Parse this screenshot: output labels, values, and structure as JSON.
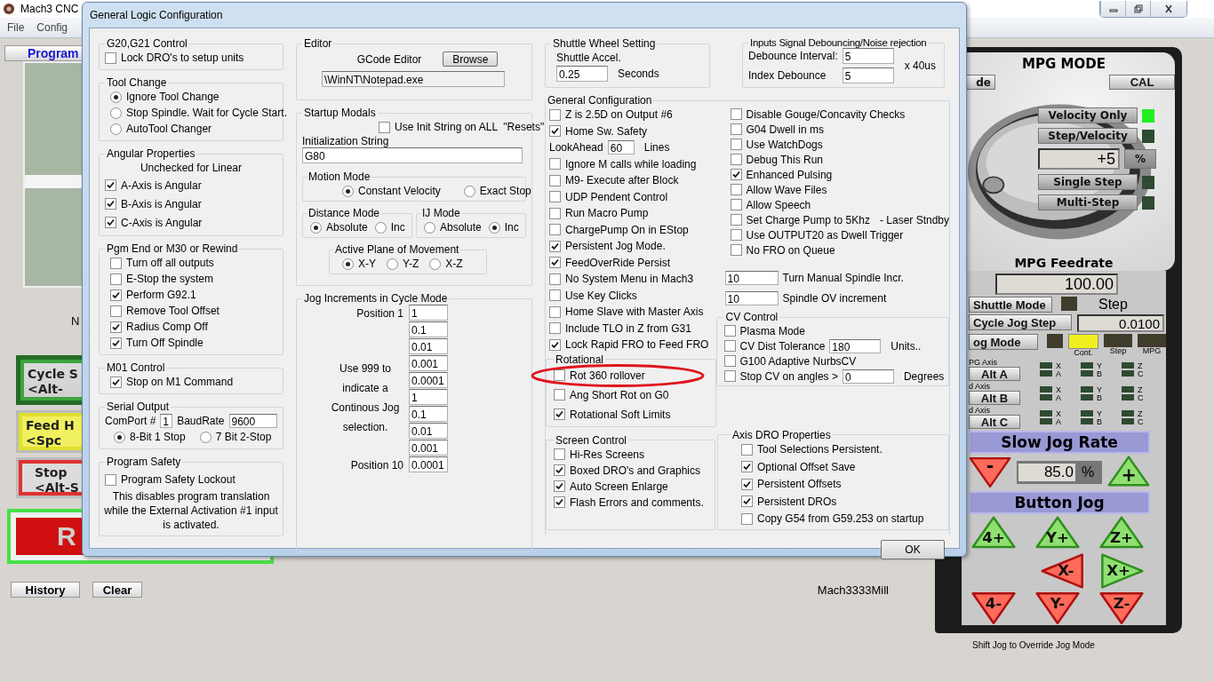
{
  "app": {
    "title": "Mach3 CNC",
    "menu": [
      "File",
      "Config"
    ],
    "tab": "Program",
    "left_label": "N",
    "big_buttons": [
      {
        "kind": "green",
        "lines": [
          "Cycle S",
          "<Alt-"
        ]
      },
      {
        "kind": "yellow",
        "lines": [
          "Feed H",
          "<Spc"
        ]
      },
      {
        "kind": "red",
        "lines": [
          "Stop",
          "<Alt-S"
        ]
      }
    ],
    "run_button": "R",
    "bottom_buttons": [
      "History",
      "Clear"
    ],
    "profile": "Mach3333Mill"
  },
  "mpg": {
    "mode_button": "de",
    "title": "MPG MODE",
    "cal": "CAL",
    "modes": [
      {
        "label": "Velocity Only",
        "on": true
      },
      {
        "label": "Step/Velocity",
        "on": false
      },
      {
        "kind": "dro",
        "value": "+5",
        "unit": "%"
      },
      {
        "label": "Single Step",
        "on": false
      },
      {
        "label": "Multi-Step",
        "on": false
      }
    ],
    "feedrate_label": "MPG Feedrate",
    "feedrate": "100.00",
    "shuttle": {
      "label": "Shuttle Mode",
      "on": false,
      "unit": "Step"
    },
    "cycle_jog": {
      "label": "Cycle Jog Step",
      "value": "0.0100"
    },
    "jog_mode": {
      "label": "og Mode",
      "on": false,
      "modes": [
        {
          "label": "Cont.",
          "on": true
        },
        {
          "label": "Step",
          "on": false
        },
        {
          "label": "MPG",
          "on": false
        }
      ]
    },
    "axes": [
      {
        "caption": "PG Axis",
        "button": "Alt A",
        "letters": [
          [
            "X",
            "A"
          ],
          [
            "Y",
            "B"
          ],
          [
            "Z",
            "C"
          ]
        ]
      },
      {
        "caption": "d Axis",
        "button": "Alt B",
        "letters": [
          [
            "X",
            "A"
          ],
          [
            "Y",
            "B"
          ],
          [
            "Z",
            "C"
          ]
        ]
      },
      {
        "caption": "d Axis",
        "button": "Alt C",
        "letters": [
          [
            "X",
            "A"
          ],
          [
            "Y",
            "B"
          ],
          [
            "Z",
            "C"
          ]
        ]
      }
    ],
    "slow_jog": {
      "title": "Slow Jog Rate",
      "minus": {
        "label": "-",
        "kind": "down"
      },
      "value": "85.0",
      "unit": "%",
      "plus": {
        "label": "+",
        "kind": "up"
      }
    },
    "button_jog": "Button Jog",
    "jog_buttons": [
      {
        "label": "4+",
        "kind": "up"
      },
      {
        "label": "Y+",
        "kind": "up"
      },
      {
        "label": "Z+",
        "kind": "up"
      },
      {
        "label": "X-",
        "kind": "left"
      },
      {
        "label": "X+",
        "kind": "right"
      },
      {
        "label": "4-",
        "kind": "down"
      },
      {
        "label": "Y-",
        "kind": "down"
      },
      {
        "label": "Z-",
        "kind": "down"
      }
    ],
    "hint": "Shift Jog to Override Jog Mode"
  },
  "dialog": {
    "title": "General Logic Configuration",
    "ok": "OK",
    "g20": {
      "title": "G20,G21 Control",
      "checkboxes": [
        {
          "label": "Lock DRO's to setup units",
          "checked": false
        }
      ]
    },
    "tool_change": {
      "title": "Tool Change",
      "radios": [
        {
          "label": "Ignore Tool Change",
          "selected": true
        },
        {
          "label": "Stop Spindle. Wait for Cycle Start.",
          "selected": false
        },
        {
          "label": "AutoTool Changer",
          "selected": false
        }
      ]
    },
    "angular": {
      "title": "Angular Properties",
      "note": "Unchecked for Linear",
      "checkboxes": [
        {
          "label": "A-Axis is Angular",
          "checked": true
        },
        {
          "label": "B-Axis is Angular",
          "checked": true
        },
        {
          "label": "C-Axis is Angular",
          "checked": true
        }
      ]
    },
    "pgm_end": {
      "title": "Pgm End or M30 or Rewind",
      "checkboxes": [
        {
          "label": "Turn off all outputs",
          "checked": false
        },
        {
          "label": "E-Stop the system",
          "checked": false
        },
        {
          "label": "Perform G92.1",
          "checked": true
        },
        {
          "label": "Remove Tool Offset",
          "checked": false
        },
        {
          "label": "Radius Comp Off",
          "checked": true
        },
        {
          "label": "Turn Off Spindle",
          "checked": true
        }
      ]
    },
    "m01": {
      "title": "M01 Control",
      "checkboxes": [
        {
          "label": "Stop on M1 Command",
          "checked": true
        }
      ]
    },
    "serial": {
      "title": "Serial Output",
      "comport_label": "ComPort #",
      "comport": "1",
      "baud_label": "BaudRate",
      "baud": "9600",
      "radios": [
        {
          "label": "8-Bit 1 Stop",
          "selected": true
        },
        {
          "label": "7 Bit 2-Stop",
          "selected": false
        }
      ]
    },
    "safety": {
      "title": "Program Safety",
      "checkboxes": [
        {
          "label": "Program Safety Lockout",
          "checked": false
        }
      ],
      "note": "This disables program translation while the External Activation #1 input is activated."
    },
    "editor": {
      "title": "Editor",
      "label": "GCode Editor",
      "browse": "Browse",
      "path": "\\WinNT\\Notepad.exe"
    },
    "startup": {
      "title": "Startup Modals",
      "init_all": {
        "label": "Use Init String on ALL  \"Resets\"",
        "checked": false
      },
      "init_label": "Initialization String",
      "init_value": "G80",
      "motion": {
        "title": "Motion Mode",
        "radios": [
          {
            "label": "Constant Velocity",
            "selected": true
          },
          {
            "label": "Exact Stop",
            "selected": false
          }
        ]
      },
      "distance": {
        "title": "Distance Mode",
        "radios": [
          {
            "label": "Absolute",
            "selected": true
          },
          {
            "label": "Inc",
            "selected": false
          }
        ]
      },
      "ij": {
        "title": "IJ Mode",
        "radios": [
          {
            "label": "Absolute",
            "selected": false
          },
          {
            "label": "Inc",
            "selected": true
          }
        ]
      },
      "plane": {
        "title": "Active Plane of Movement",
        "radios": [
          {
            "label": "X-Y",
            "selected": true
          },
          {
            "label": "Y-Z",
            "selected": false
          },
          {
            "label": "X-Z",
            "selected": false
          }
        ]
      }
    },
    "jog": {
      "title": "Jog Increments in Cycle Mode",
      "first_label": "Position 1",
      "last_label": "Position 10",
      "note": "Use 999 to indicate a Continous Jog selection.",
      "values": [
        "1",
        "0.1",
        "0.01",
        "0.001",
        "0.0001",
        "1",
        "0.1",
        "0.01",
        "0.001",
        "0.0001"
      ]
    },
    "shuttle": {
      "title": "Shuttle Wheel Setting",
      "label": "Shuttle Accel.",
      "value": "0.25",
      "unit": "Seconds"
    },
    "debounce": {
      "title": "Inputs Signal Debouncing/Noise rejection",
      "interval_label": "Debounce Interval:",
      "interval": "5",
      "index_label": "Index Debounce",
      "index": "5",
      "unit": "x 40us"
    },
    "general": {
      "title": "General Configuration",
      "left": [
        {
          "kind": "checkbox",
          "label": "Z is 2.5D on Output #6",
          "checked": false
        },
        {
          "kind": "checkbox",
          "label": "Home Sw. Safety",
          "checked": true
        },
        {
          "kind": "field",
          "label": "LookAhead",
          "value": "60",
          "unit": "Lines"
        },
        {
          "kind": "checkbox",
          "label": "Ignore M calls while loading",
          "checked": false
        },
        {
          "kind": "checkbox",
          "label": "M9- Execute after Block",
          "checked": false
        },
        {
          "kind": "checkbox",
          "label": "UDP Pendent Control",
          "checked": false
        },
        {
          "kind": "checkbox",
          "label": "Run Macro Pump",
          "checked": false
        },
        {
          "kind": "checkbox",
          "label": "ChargePump On in EStop",
          "checked": false
        },
        {
          "kind": "checkbox",
          "label": "Persistent Jog Mode.",
          "checked": true
        },
        {
          "kind": "checkbox",
          "label": "FeedOverRide Persist",
          "checked": true
        },
        {
          "kind": "checkbox",
          "label": "No System Menu in Mach3",
          "checked": false
        },
        {
          "kind": "checkbox",
          "label": "Use Key Clicks",
          "checked": false
        },
        {
          "kind": "checkbox",
          "label": "Home Slave with Master Axis",
          "checked": false
        },
        {
          "kind": "checkbox",
          "label": "Include TLO in Z from G31",
          "checked": false
        },
        {
          "kind": "checkbox",
          "label": "Lock Rapid FRO to Feed FRO",
          "checked": true
        }
      ],
      "rotational": {
        "title": "Rotational",
        "checkboxes": [
          {
            "label": "Rot 360 rollover",
            "checked": false,
            "circled": true
          },
          {
            "label": "Ang Short Rot on G0",
            "checked": false,
            "circled": false
          },
          {
            "label": "Rotational Soft Limits",
            "checked": true,
            "circled": false
          }
        ]
      },
      "right": [
        {
          "kind": "checkbox",
          "label": "Disable Gouge/Concavity Checks",
          "checked": false
        },
        {
          "kind": "checkbox",
          "label": "G04 Dwell in ms",
          "checked": false
        },
        {
          "kind": "checkbox",
          "label": "Use WatchDogs",
          "checked": false
        },
        {
          "kind": "checkbox",
          "label": "Debug This Run",
          "checked": false
        },
        {
          "kind": "checkbox",
          "label": "Enhanced Pulsing",
          "checked": true
        },
        {
          "kind": "checkbox",
          "label": "Allow Wave Files",
          "checked": false
        },
        {
          "kind": "checkbox",
          "label": "Allow Speech",
          "checked": false
        },
        {
          "kind": "checkbox",
          "label": "Set Charge Pump to 5Khz",
          "checked": false,
          "note": "- Laser Stndby"
        },
        {
          "kind": "checkbox",
          "label": "Use OUTPUT20 as Dwell Trigger",
          "checked": false
        },
        {
          "kind": "checkbox",
          "label": "No FRO on Queue",
          "checked": false
        },
        {
          "kind": "field_first",
          "value": "10",
          "caption": "Turn Manual Spindle Incr."
        },
        {
          "kind": "field_first",
          "value": "10",
          "caption": "Spindle OV increment"
        }
      ],
      "cv": {
        "title": "CV Control",
        "items": [
          {
            "kind": "checkbox",
            "label": "Plasma Mode",
            "checked": false
          },
          {
            "kind": "checkbox",
            "label": "CV Dist Tolerance",
            "checked": false,
            "value": "180",
            "unit": "Units.."
          },
          {
            "kind": "checkbox",
            "label": "G100 Adaptive NurbsCV",
            "checked": false
          },
          {
            "kind": "checkbox",
            "label": "Stop CV on angles >",
            "checked": false,
            "value": "0",
            "unit": "Degrees"
          }
        ]
      }
    },
    "screen": {
      "title": "Screen Control",
      "checkboxes": [
        {
          "label": "Hi-Res Screens",
          "checked": false
        },
        {
          "label": "Boxed DRO's and Graphics",
          "checked": true
        },
        {
          "label": "Auto Screen Enlarge",
          "checked": true
        },
        {
          "label": "Flash Errors and comments.",
          "checked": true
        }
      ]
    },
    "axis_dro": {
      "title": "Axis DRO Properties",
      "checkboxes": [
        {
          "label": "Tool Selections Persistent.",
          "checked": false
        },
        {
          "label": "Optional Offset Save",
          "checked": true
        },
        {
          "label": "Persistent Offsets",
          "checked": true
        },
        {
          "label": "Persistent DROs",
          "checked": true
        },
        {
          "label": "Copy G54 from G59.253 on startup",
          "checked": false
        }
      ]
    }
  }
}
